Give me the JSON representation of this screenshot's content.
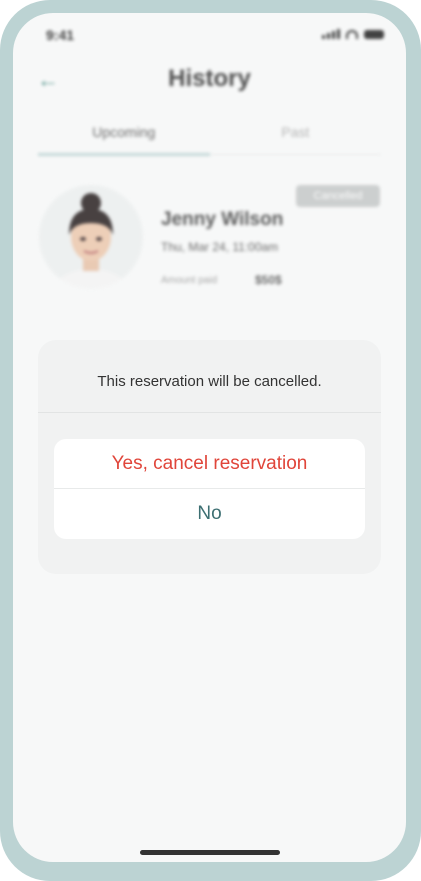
{
  "status_bar": {
    "time": "9:41"
  },
  "header": {
    "title": "History",
    "back_icon": "arrow-left-icon"
  },
  "tabs": [
    {
      "label": "Upcoming",
      "active": true
    },
    {
      "label": "Past",
      "active": false
    }
  ],
  "reservation": {
    "name": "Jenny Wilson",
    "datetime": "Thu, Mar 24, 11:00am",
    "amount_label": "Amount paid",
    "amount_value": "$50$",
    "status_badge": "Cancelled"
  },
  "dialog": {
    "message": "This reservation will be cancelled.",
    "confirm_label": "Yes, cancel reservation",
    "cancel_label": "No"
  },
  "colors": {
    "accent": "#4a8f85",
    "frame": "#bcd3d3",
    "destructive": "#e0453a",
    "cancel": "#3d6f72"
  }
}
